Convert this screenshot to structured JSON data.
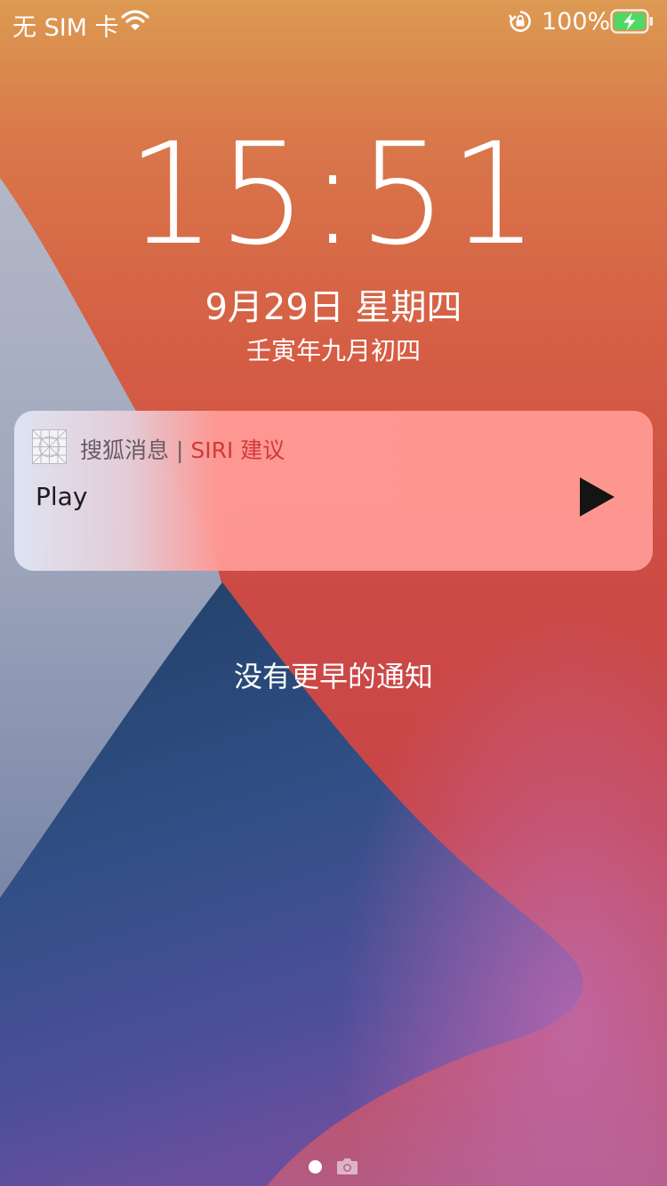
{
  "status_bar": {
    "carrier": "无 SIM 卡",
    "battery_percent": "100%",
    "icons": [
      "wifi-icon",
      "rotation-lock-icon",
      "battery-charging-icon"
    ]
  },
  "lockscreen": {
    "time": "15:51",
    "date": "9月29日 星期四",
    "lunar_date": "壬寅年九月初四"
  },
  "notification": {
    "app_name": "搜狐消息",
    "separator": "|",
    "source": "SIRI 建议",
    "title": "Play",
    "action_icon": "play-icon"
  },
  "footer": {
    "no_older_notifications": "没有更早的通知",
    "icons": [
      "page-dot",
      "camera-icon"
    ]
  },
  "colors": {
    "notification_tint": "#ff9892",
    "siri_accent": "#d23a3a",
    "battery_green": "#4cd964"
  }
}
